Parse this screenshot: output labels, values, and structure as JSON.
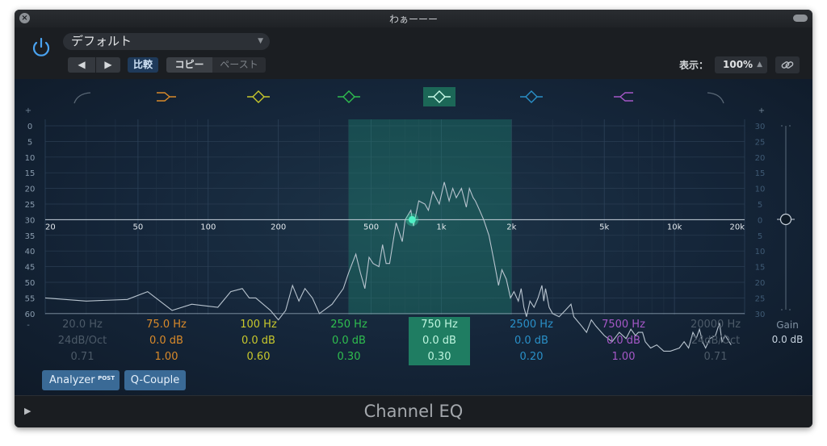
{
  "window": {
    "title": "わぁーーー"
  },
  "toolbar": {
    "preset": "デフォルト",
    "prev": "◀",
    "next": "▶",
    "compare": "比較",
    "copy": "コピー",
    "paste": "ペースト",
    "view_label": "表示：",
    "zoom": "100%"
  },
  "scales": {
    "left_plus": "+",
    "left_minus": "-",
    "right_plus": "+",
    "left": [
      "0",
      "5",
      "10",
      "15",
      "20",
      "25",
      "30",
      "35",
      "40",
      "45",
      "50",
      "55",
      "60"
    ],
    "right": [
      "30",
      "25",
      "20",
      "15",
      "10",
      "5",
      "0",
      "5",
      "10",
      "15",
      "20",
      "25",
      "30"
    ],
    "freq_ticks": [
      {
        "label": "20",
        "hz": 20
      },
      {
        "label": "50",
        "hz": 50
      },
      {
        "label": "100",
        "hz": 100
      },
      {
        "label": "200",
        "hz": 200
      },
      {
        "label": "500",
        "hz": 500
      },
      {
        "label": "1k",
        "hz": 1000
      },
      {
        "label": "2k",
        "hz": 2000
      },
      {
        "label": "5k",
        "hz": 5000
      },
      {
        "label": "10k",
        "hz": 10000
      },
      {
        "label": "20k",
        "hz": 20000
      }
    ]
  },
  "bands": [
    {
      "freq": "20.0 Hz",
      "gain": "24dB/Oct",
      "q": "0.71",
      "color": "#4a5664",
      "icon": "low-cut-icon",
      "active": false
    },
    {
      "freq": "75.0 Hz",
      "gain": "0.0 dB",
      "q": "1.00",
      "color": "#d98a2a",
      "icon": "low-shelf-icon",
      "active": false
    },
    {
      "freq": "100 Hz",
      "gain": "0.0 dB",
      "q": "0.60",
      "color": "#c8c82c",
      "icon": "bell-icon",
      "active": false
    },
    {
      "freq": "250 Hz",
      "gain": "0.0 dB",
      "q": "0.30",
      "color": "#2fbe4f",
      "icon": "bell-icon",
      "active": false
    },
    {
      "freq": "750 Hz",
      "gain": "0.0 dB",
      "q": "0.30",
      "color": "#3fd4a4",
      "icon": "bell-icon",
      "active": true
    },
    {
      "freq": "2500 Hz",
      "gain": "0.0 dB",
      "q": "0.20",
      "color": "#2a90c8",
      "icon": "bell-icon",
      "active": false
    },
    {
      "freq": "7500 Hz",
      "gain": "0.0 dB",
      "q": "1.00",
      "color": "#a658c8",
      "icon": "high-shelf-icon",
      "active": false
    },
    {
      "freq": "20000 Hz",
      "gain": "24dB/Oct",
      "q": "0.71",
      "color": "#4a5664",
      "icon": "high-cut-icon",
      "active": false
    }
  ],
  "buttons": {
    "analyzer": "Analyzer",
    "analyzer_post": "POST",
    "qcouple": "Q-Couple"
  },
  "gain": {
    "label": "Gain",
    "value": "0.0 dB"
  },
  "footer": {
    "title": "Channel EQ",
    "play": "▶"
  },
  "chart_data": {
    "type": "line",
    "x_scale": "log",
    "xlim_hz": [
      20,
      20000
    ],
    "y_units": "analyzer level (left scale)",
    "selected_band_range_hz": [
      400,
      2000
    ],
    "selected_band_node": {
      "hz": 750,
      "gain_db": 0
    },
    "spectrum": [
      [
        20,
        55
      ],
      [
        30,
        56
      ],
      [
        45,
        55.5
      ],
      [
        55,
        53
      ],
      [
        70,
        59
      ],
      [
        85,
        57
      ],
      [
        110,
        58
      ],
      [
        125,
        53
      ],
      [
        140,
        52
      ],
      [
        150,
        55
      ],
      [
        160,
        55
      ],
      [
        185,
        59
      ],
      [
        200,
        62
      ],
      [
        215,
        59
      ],
      [
        230,
        51
      ],
      [
        245,
        56
      ],
      [
        260,
        52
      ],
      [
        280,
        55
      ],
      [
        300,
        60
      ],
      [
        340,
        57
      ],
      [
        380,
        52
      ],
      [
        400,
        47
      ],
      [
        430,
        41
      ],
      [
        450,
        47
      ],
      [
        470,
        52
      ],
      [
        490,
        42
      ],
      [
        510,
        44
      ],
      [
        540,
        45
      ],
      [
        560,
        38
      ],
      [
        580,
        44
      ],
      [
        600,
        44
      ],
      [
        640,
        31
      ],
      [
        680,
        37
      ],
      [
        700,
        30
      ],
      [
        740,
        27
      ],
      [
        760,
        32
      ],
      [
        800,
        24
      ],
      [
        850,
        25
      ],
      [
        880,
        27
      ],
      [
        920,
        21
      ],
      [
        980,
        25
      ],
      [
        1030,
        18
      ],
      [
        1080,
        24
      ],
      [
        1120,
        20
      ],
      [
        1160,
        23
      ],
      [
        1220,
        20
      ],
      [
        1280,
        26
      ],
      [
        1320,
        20
      ],
      [
        1370,
        23
      ],
      [
        1400,
        24
      ],
      [
        1460,
        27
      ],
      [
        1520,
        30
      ],
      [
        1600,
        35
      ],
      [
        1640,
        39
      ],
      [
        1700,
        45
      ],
      [
        1760,
        51
      ],
      [
        1820,
        46
      ],
      [
        1900,
        49
      ],
      [
        1980,
        55
      ],
      [
        2050,
        53
      ],
      [
        2140,
        56
      ],
      [
        2200,
        52
      ],
      [
        2260,
        58
      ],
      [
        2320,
        61
      ],
      [
        2400,
        56
      ],
      [
        2500,
        58
      ],
      [
        2600,
        55
      ],
      [
        2700,
        51
      ],
      [
        2750,
        56
      ],
      [
        2800,
        52
      ],
      [
        2900,
        58
      ],
      [
        3000,
        60
      ],
      [
        3200,
        61
      ],
      [
        3400,
        59
      ],
      [
        3600,
        57
      ],
      [
        3700,
        61
      ],
      [
        3800,
        62
      ],
      [
        4000,
        64
      ],
      [
        4200,
        66
      ],
      [
        4400,
        62
      ],
      [
        4600,
        64
      ],
      [
        5000,
        67
      ],
      [
        5400,
        69
      ],
      [
        5800,
        66
      ],
      [
        6200,
        68
      ],
      [
        6500,
        65
      ],
      [
        6800,
        67
      ],
      [
        7000,
        66
      ],
      [
        7300,
        66
      ],
      [
        7500,
        69
      ],
      [
        7900,
        71
      ],
      [
        8400,
        70
      ],
      [
        9000,
        72
      ],
      [
        9600,
        72
      ],
      [
        10500,
        71
      ],
      [
        11000,
        69
      ],
      [
        11500,
        71
      ],
      [
        12000,
        66
      ],
      [
        12400,
        68
      ],
      [
        12800,
        65
      ],
      [
        13200,
        69
      ],
      [
        13600,
        71
      ],
      [
        14200,
        68
      ],
      [
        15000,
        67
      ],
      [
        15600,
        63
      ],
      [
        16000,
        69
      ],
      [
        16500,
        67
      ],
      [
        17500,
        70
      ]
    ]
  }
}
